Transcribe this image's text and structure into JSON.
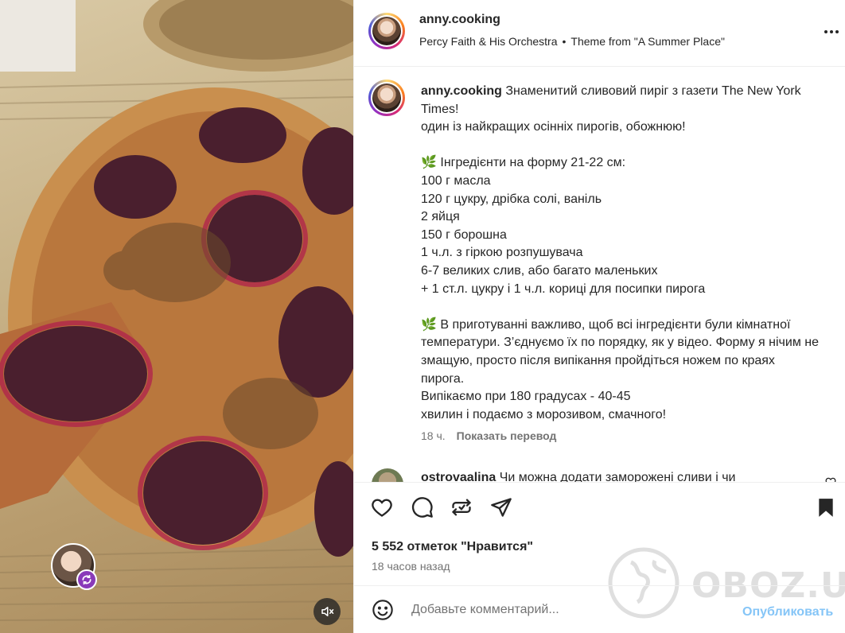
{
  "post": {
    "username": "anny.cooking",
    "music": {
      "artist": "Percy Faith & His Orchestra",
      "separator": "•",
      "track": "Theme from \"A Summer Place\""
    }
  },
  "caption": {
    "username": "anny.cooking",
    "lines": [
      "Знаменитий сливовий пиріг з газети The New York Times!",
      "один із найкращих осінніх пирогів, обожнюю!",
      "",
      "🌿 Інгредієнти на форму 21-22 см:",
      "100 г масла",
      "120 г цукру, дрібка солі, ваніль",
      "2 яйця",
      "150 г борошна",
      "1 ч.л. з гіркою розпушувача",
      "6-7 великих слив, або багато маленьких",
      "+ 1 ст.л. цукру і 1 ч.л. кориці для посипки пирога",
      "",
      "🌿 В приготуванні важливо, щоб всі інгредієнти були кімнатної температури. З’єднуємо їх по порядку, як у відео. Форму я нічим не змащую, просто після випікання пройдіться ножем по краях пирога.",
      "Випікаємо при 180 градусах - 40-45",
      "хвилин і подаємо з морозивом, смачного!"
    ],
    "time": "18 ч.",
    "translate_label": "Показать перевод"
  },
  "comment": {
    "username": "ostrovaalina",
    "text": "Чи можна додати заморожені сливи і чи"
  },
  "actions": {
    "like_icon": "heart-icon",
    "comment_icon": "comment-icon",
    "share_icon": "repost-icon",
    "send_icon": "send-icon",
    "save_icon": "bookmark-icon"
  },
  "likes_text": "5 552 отметок \"Нравится\"",
  "posted_ago": "18 часов назад",
  "composer": {
    "placeholder": "Добавьте комментарий...",
    "publish_label": "Опубликовать"
  },
  "watermark": "OBOZ.UA",
  "colors": {
    "accent": "#0095f6",
    "publish_disabled": "#85c5f7",
    "muted": "#737373"
  }
}
